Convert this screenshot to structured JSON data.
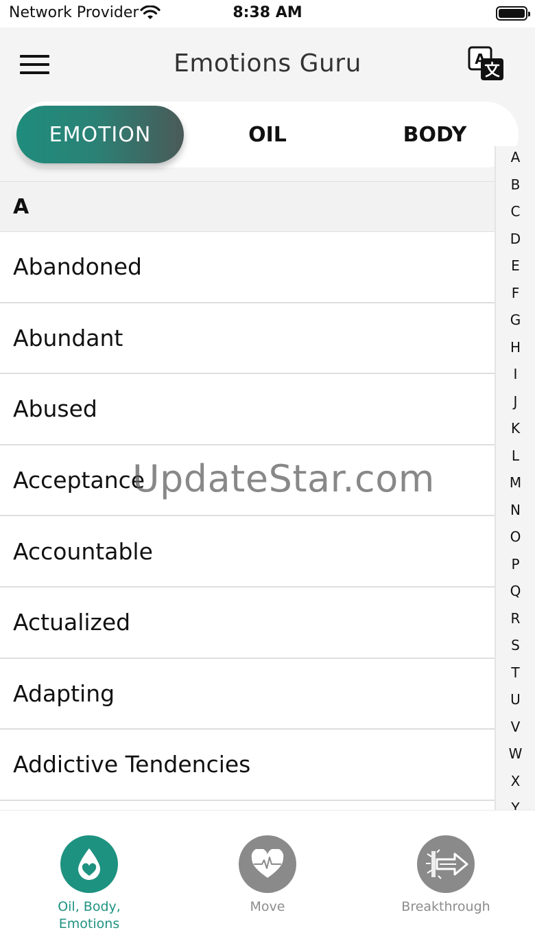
{
  "status_bar": {
    "carrier": "Network Provider",
    "time": "8:38 AM"
  },
  "header": {
    "title": "Emotions Guru",
    "menu_icon": "hamburger-menu-icon",
    "translate_icon": "translate-icon"
  },
  "segments": {
    "emotion": "EMOTION",
    "oil": "OIL",
    "body": "BODY",
    "selected": "EMOTION"
  },
  "list": {
    "section": "A",
    "items": [
      "Abandoned",
      "Abundant",
      "Abused",
      "Acceptance",
      "Accountable",
      "Actualized",
      "Adapting",
      "Addictive Tendencies"
    ]
  },
  "alphabet": [
    "A",
    "B",
    "C",
    "D",
    "E",
    "F",
    "G",
    "H",
    "I",
    "J",
    "K",
    "L",
    "M",
    "N",
    "O",
    "P",
    "Q",
    "R",
    "S",
    "T",
    "U",
    "V",
    "W",
    "X",
    "Y"
  ],
  "watermark": "UpdateStar.com",
  "tabbar": {
    "tabs": [
      {
        "label": "Oil, Body,\nEmotions",
        "icon": "oil-drop-heart-icon",
        "active": true
      },
      {
        "label": "Move",
        "icon": "heart-pulse-icon",
        "active": false
      },
      {
        "label": "Breakthrough",
        "icon": "breakthrough-arrow-icon",
        "active": false
      }
    ]
  },
  "colors": {
    "accent": "#1e9280",
    "inactive": "#8a8a8a",
    "header_bg": "#f4f4f4"
  }
}
